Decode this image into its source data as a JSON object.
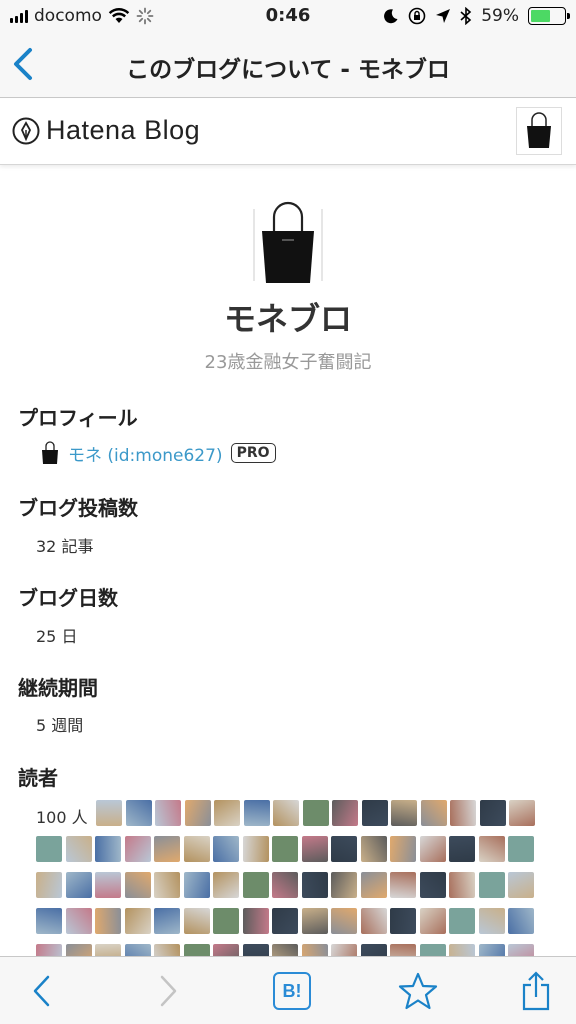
{
  "status_bar": {
    "carrier": "docomo",
    "time": "0:46",
    "battery_percent": "59%",
    "battery_level": 0.59
  },
  "nav": {
    "title": "このブログについて - モネブロ"
  },
  "header": {
    "logo_text": "Hatena Blog"
  },
  "blog": {
    "title": "モネブロ",
    "description": "23歳金融女子奮闘記"
  },
  "sections": {
    "profile": {
      "heading": "プロフィール",
      "user_link": "モネ (id:mone627)",
      "badge": "PRO"
    },
    "posts": {
      "heading": "ブログ投稿数",
      "value": "32 記事"
    },
    "days": {
      "heading": "ブログ日数",
      "value": "25 日"
    },
    "duration": {
      "heading": "継続期間",
      "value": "5 週間"
    },
    "readers": {
      "heading": "読者",
      "count": "100 人"
    }
  },
  "toolbar": {
    "bookmark_label": "B!"
  },
  "colors": {
    "accent": "#1a82c8",
    "link": "#3c99c9",
    "battery": "#4cd964",
    "hatena_bookmark": "#2a8bd6"
  }
}
